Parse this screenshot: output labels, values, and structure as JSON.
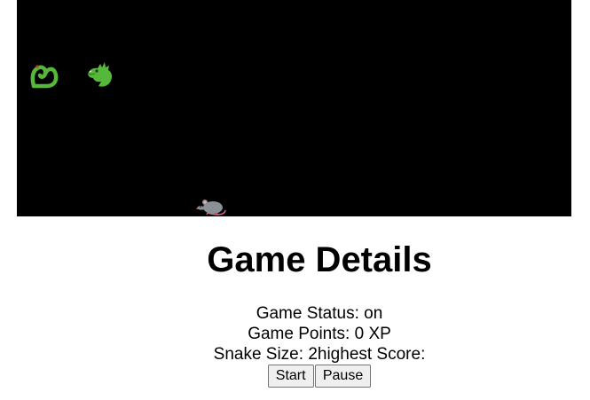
{
  "game": {
    "background": "#000000",
    "snake_color": "#55b83a",
    "snake_tail_icon": "snake-tail-icon",
    "snake_head_icon": "dragon-head-icon",
    "food_icon": "rat-icon"
  },
  "details": {
    "title": "Game Details",
    "status_label": "Game Status: ",
    "status_value": "on",
    "points_label": "Game Points: ",
    "points_value": "0",
    "points_unit": " XP",
    "size_label": "Snake Size: ",
    "size_value": "2",
    "highest_label": "highest Score:",
    "highest_value": ""
  },
  "controls": {
    "start_label": "Start",
    "pause_label": "Pause"
  }
}
